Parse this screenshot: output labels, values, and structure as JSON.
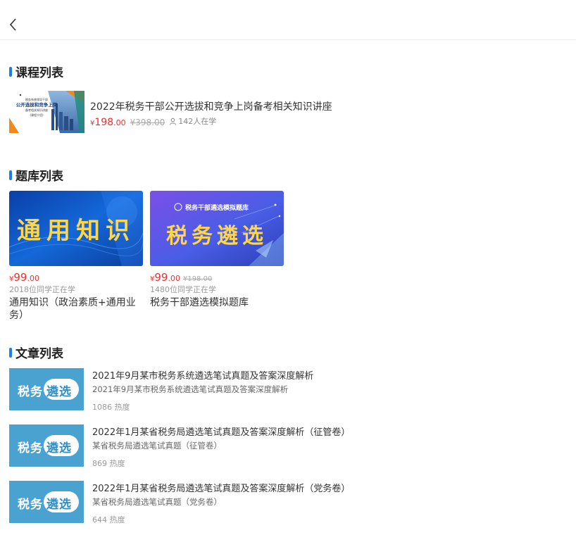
{
  "nav": {
    "back_icon": "chevron-left-icon"
  },
  "sections": {
    "courses": "课程列表",
    "banks": "题库列表",
    "articles": "文章列表"
  },
  "course": {
    "thumb_lines": [
      "税务系统领导干部",
      "公开选拔和竞争上岗",
      "备考相关知识讲座",
      "(课程介绍)"
    ],
    "name": "2022年税务干部公开选拔和竞争上岗备考相关知识讲座",
    "currency": "¥",
    "price_int": "198",
    "price_dec": ".00",
    "old_price": "¥398.00",
    "learners": "142人在学"
  },
  "banks": [
    {
      "cover_text": "通用知识",
      "currency": "¥",
      "price_int": "99",
      "price_dec": ".00",
      "old_price": "",
      "count": "2018位同学正在学",
      "name": "通用知识（政治素质+通用业务）"
    },
    {
      "cover_header": "税务干部遴选模拟题库",
      "cover_text": "税务遴选",
      "currency": "¥",
      "price_int": "99",
      "price_dec": ".00",
      "old_price": "¥198.00",
      "count": "1480位同学正在学",
      "name": "税务干部遴选模拟题库"
    }
  ],
  "article_thumb": {
    "left": "税务",
    "right": "遴选"
  },
  "articles": [
    {
      "title": "2021年9月某市税务系统遴选笔试真题及答案深度解析",
      "subtitle": "2021年9月某市税务系统遴选笔试真题及答案深度解析",
      "heat": "1086 热度"
    },
    {
      "title": "2022年1月某省税务局遴选笔试真题及答案深度解析（征管卷）",
      "subtitle": "某省税务局遴选笔试真题（征管卷）",
      "heat": "869 热度"
    },
    {
      "title": "2022年1月某省税务局遴选笔试真题及答案深度解析（党务卷）",
      "subtitle": "某省税务局遴选笔试真题（党务卷）",
      "heat": "644 热度"
    }
  ],
  "colors": {
    "accent": "#1f7fe0",
    "price": "#e8302d"
  }
}
